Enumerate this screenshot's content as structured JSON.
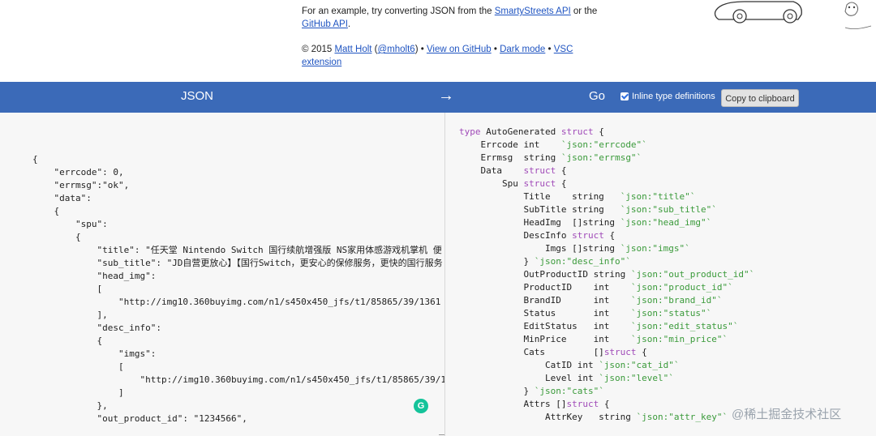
{
  "intro": {
    "line1_prefix": "For an example, try converting JSON from the ",
    "link_smartystreets": "SmartyStreets API",
    "line1_mid": " or the",
    "link_github_api": "GitHub API",
    "line1_end": ".",
    "copyright": "© 2015 ",
    "author": "Matt Holt",
    "paren_open": " (",
    "handle": "@mholt6",
    "paren_close": ") • ",
    "view_github": "View on GitHub",
    "sep1": " • ",
    "dark_mode": "Dark mode",
    "sep2": " • ",
    "vsc": "VSC",
    "vsc2": "extension"
  },
  "bar": {
    "json_label": "JSON",
    "arrow": "→",
    "go_label": "Go",
    "inline_label": "Inline type definitions",
    "inline_checked": true,
    "copy_label": "Copy to clipboard",
    "color": "#3b6ab8"
  },
  "json_lines": [
    "{",
    "    \"errcode\": 0,",
    "    \"errmsg\":\"ok\",",
    "    \"data\":",
    "    {",
    "        \"spu\":",
    "        {",
    "            \"title\": \"任天堂 Nintendo Switch 国行续航增强版 NS家用体感游戏机掌机 便",
    "            \"sub_title\": \"JD自营更放心】【国行Switch，更安心的保修服务，更快的国行服务",
    "            \"head_img\":",
    "            [",
    "                \"http://img10.360buyimg.com/n1/s450x450_jfs/t1/85865/39/1361",
    "            ],",
    "            \"desc_info\":",
    "            {",
    "                \"imgs\":",
    "                [",
    "                    \"http://img10.360buyimg.com/n1/s450x450_jfs/t1/85865/39/1",
    "                ]",
    "            },",
    "            \"out_product_id\": \"1234566\","
  ],
  "go_lines": [
    {
      "text": "type AutoGenerated struct {"
    },
    {
      "text": "    Errcode int    `json:\"errcode\"`"
    },
    {
      "text": "    Errmsg  string `json:\"errmsg\"`"
    },
    {
      "text": "    Data    struct {"
    },
    {
      "text": "        Spu struct {"
    },
    {
      "text": "            Title    string   `json:\"title\"`"
    },
    {
      "text": "            SubTitle string   `json:\"sub_title\"`"
    },
    {
      "text": "            HeadImg  []string `json:\"head_img\"`"
    },
    {
      "text": "            DescInfo struct {"
    },
    {
      "text": "                Imgs []string `json:\"imgs\"`"
    },
    {
      "text": "            } `json:\"desc_info\"`"
    },
    {
      "text": "            OutProductID string `json:\"out_product_id\"`"
    },
    {
      "text": "            ProductID    int    `json:\"product_id\"`"
    },
    {
      "text": "            BrandID      int    `json:\"brand_id\"`"
    },
    {
      "text": "            Status       int    `json:\"status\"`"
    },
    {
      "text": "            EditStatus   int    `json:\"edit_status\"`"
    },
    {
      "text": "            MinPrice     int    `json:\"min_price\"`"
    },
    {
      "text": "            Cats         []struct {"
    },
    {
      "text": "                CatID int `json:\"cat_id\"`"
    },
    {
      "text": "                Level int `json:\"level\"`"
    },
    {
      "text": "            } `json:\"cats\"`"
    },
    {
      "text": "            Attrs []struct {"
    },
    {
      "text": "                AttrKey   string `json:\"attr_key\"`"
    }
  ],
  "grammarly_letter": "G",
  "watermark": "@稀土掘金技术社区"
}
